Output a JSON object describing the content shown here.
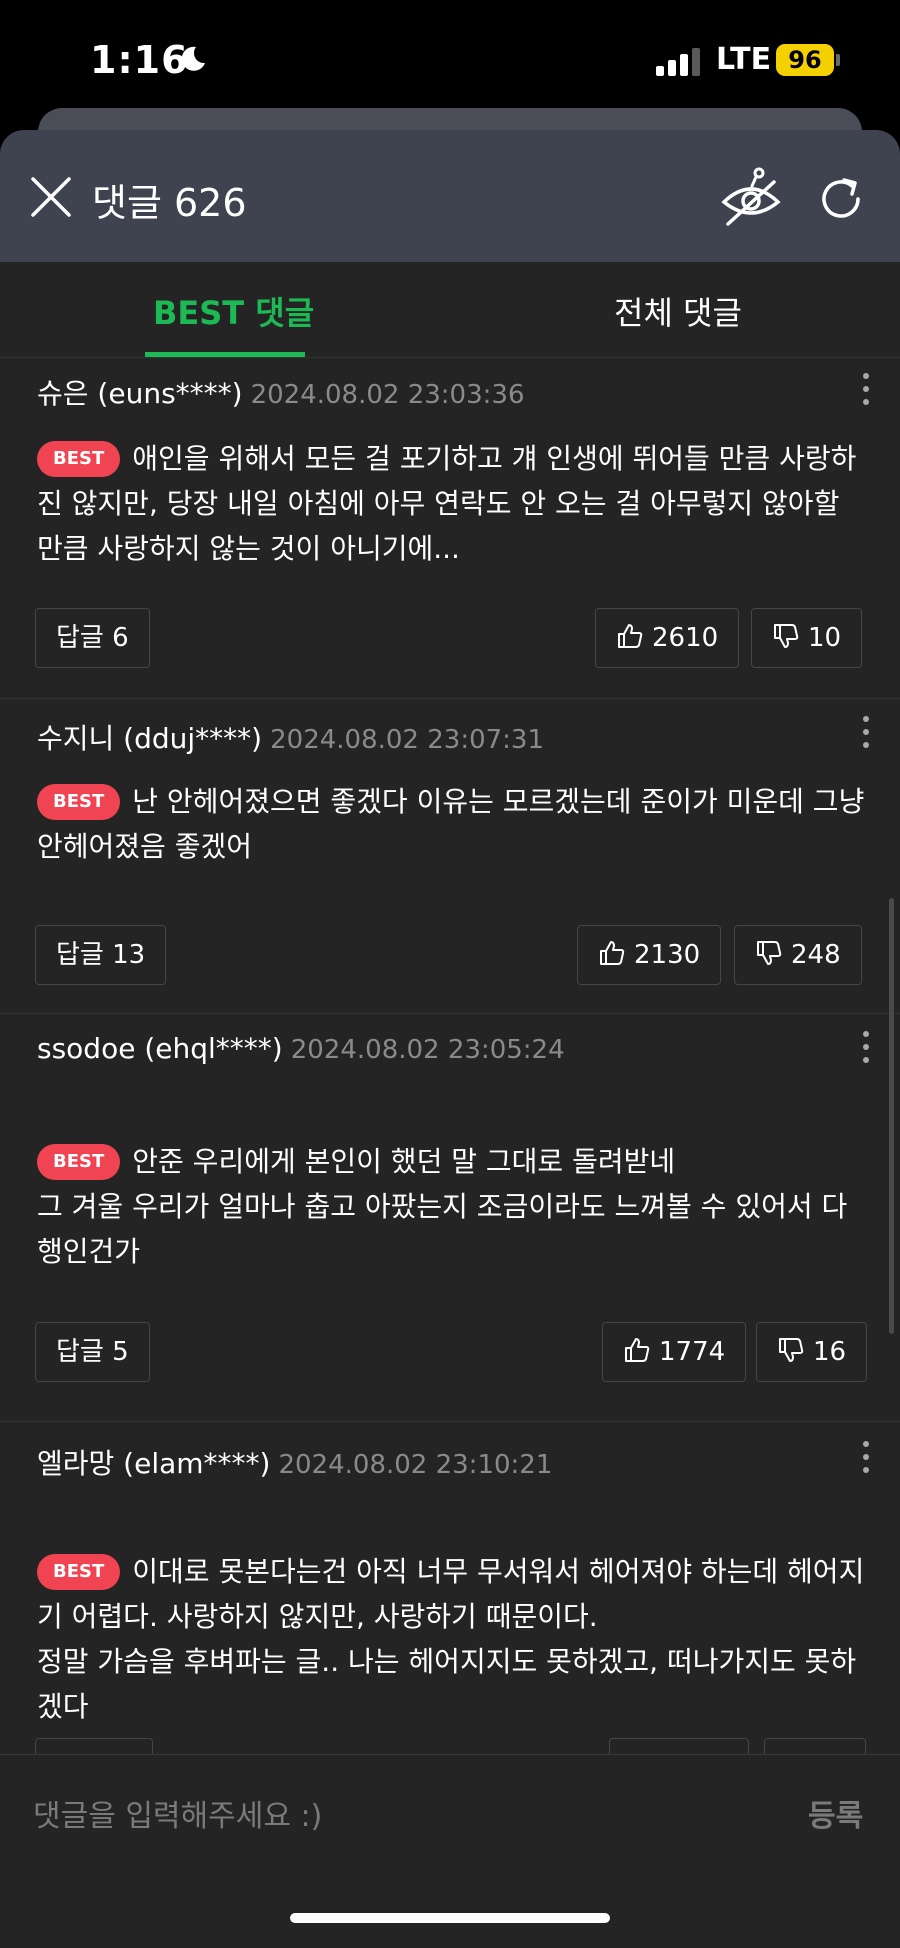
{
  "status_bar": {
    "time": "1:16",
    "network": "LTE",
    "battery": "96"
  },
  "header": {
    "title": "댓글 626"
  },
  "tabs": [
    {
      "label": "BEST 댓글",
      "active": true
    },
    {
      "label": "전체 댓글",
      "active": false
    }
  ],
  "badge_label": "BEST",
  "comments": [
    {
      "author": "슈은 (euns****)",
      "date": "2024.08.02 23:03:36",
      "text": "애인을 위해서 모든 걸 포기하고 걔 인생에 뛰어들 만큼 사랑하진 않지만, 당장 내일 아침에 아무 연락도 안 오는 걸 아무렇지 않아할 만큼 사랑하지 않는 것이 아니기에...",
      "reply_label": "답글 6",
      "likes": "2610",
      "dislikes": "10"
    },
    {
      "author": "수지니 (dduj****)",
      "date": "2024.08.02 23:07:31",
      "text": "난 안헤어졌으면 좋겠다 이유는 모르겠는데 준이가 미운데 그냥 안헤어졌음 좋겠어",
      "reply_label": "답글 13",
      "likes": "2130",
      "dislikes": "248"
    },
    {
      "author": "ssodoe (ehql****)",
      "date": "2024.08.02 23:05:24",
      "text": "안준 우리에게 본인이 했던 말 그대로 돌려받네\n그 겨울 우리가 얼마나 춥고 아팠는지 조금이라도 느껴볼 수 있어서 다행인건가",
      "reply_label": "답글 5",
      "likes": "1774",
      "dislikes": "16"
    },
    {
      "author": "엘라망 (elam****)",
      "date": "2024.08.02 23:10:21",
      "text": "이대로 못본다는건 아직 너무 무서워서 헤어져야 하는데 헤어지기 어렵다. 사랑하지 않지만, 사랑하기 때문이다.\n정말 가슴을 후벼파는 글.. 나는 헤어지지도 못하겠고, 떠나가지도 못하겠다",
      "reply_label": "",
      "likes": "",
      "dislikes": ""
    }
  ],
  "input": {
    "placeholder": "댓글을 입력해주세요 :)",
    "submit_label": "등록"
  },
  "colors": {
    "accent": "#1db954",
    "badge": "#f04452",
    "background": "#242424",
    "header": "#3f434f",
    "battery": "#f5d000"
  }
}
